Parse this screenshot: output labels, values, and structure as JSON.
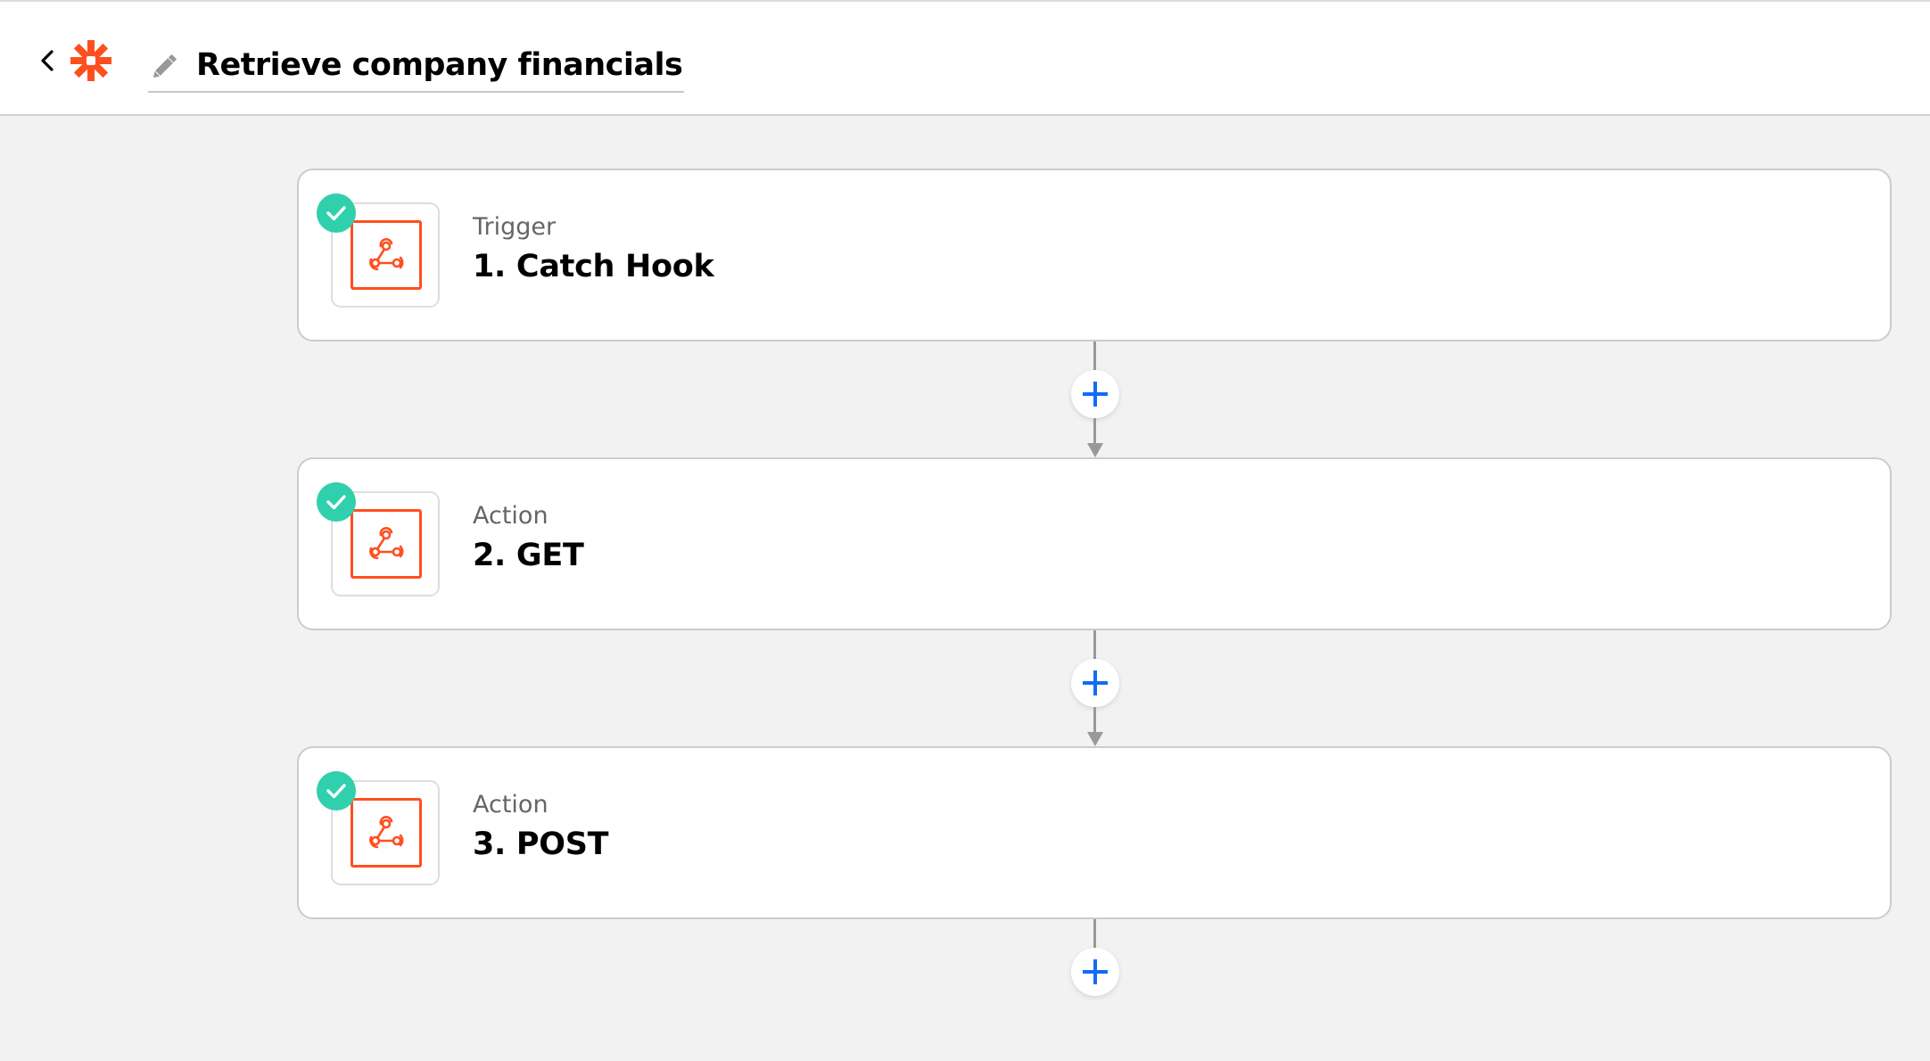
{
  "header": {
    "back_label": "Back",
    "logo_icon": "zapier-asterisk-logo",
    "edit_icon": "pencil-icon",
    "title": "Retrieve company financials"
  },
  "colors": {
    "brand": "#ff4f1f",
    "success": "#2fd0ab",
    "add_accent": "#136bf5",
    "connector": "#999999",
    "background": "#f2f2f2"
  },
  "steps": [
    {
      "type": "Trigger",
      "title": "1. Catch Hook",
      "status": "complete",
      "app_icon": "webhook-icon"
    },
    {
      "type": "Action",
      "title": "2. GET",
      "status": "complete",
      "app_icon": "webhook-icon"
    },
    {
      "type": "Action",
      "title": "3. POST",
      "status": "complete",
      "app_icon": "webhook-icon"
    }
  ],
  "add_step_buttons": [
    {
      "label": "Add step after 1"
    },
    {
      "label": "Add step after 2"
    },
    {
      "label": "Add step after 3"
    }
  ]
}
